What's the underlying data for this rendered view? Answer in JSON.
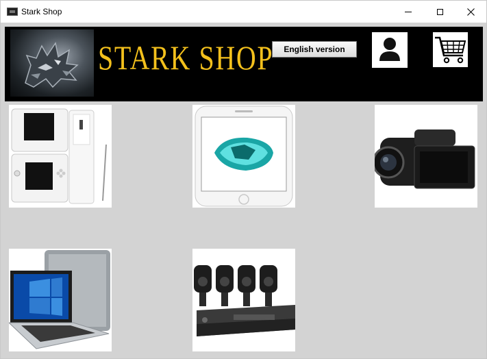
{
  "window": {
    "title": "Stark Shop",
    "controls": [
      "minimize",
      "maximize",
      "close"
    ]
  },
  "header": {
    "brand": "STARK SHOP",
    "logo_icon": "wolf-emblem-icon",
    "language_button_label": "English version",
    "user_icon": "user-icon",
    "cart_icon": "shopping-cart-icon"
  },
  "products": [
    {
      "icon": "handheld-console-image"
    },
    {
      "icon": "smartphone-image"
    },
    {
      "icon": "camcorder-image"
    },
    {
      "icon": "laptop-image"
    },
    {
      "icon": "security-camera-kit-image"
    }
  ],
  "colors": {
    "background": "#d3d3d3",
    "banner": "#000000",
    "brand_text": "#f3c01c"
  }
}
